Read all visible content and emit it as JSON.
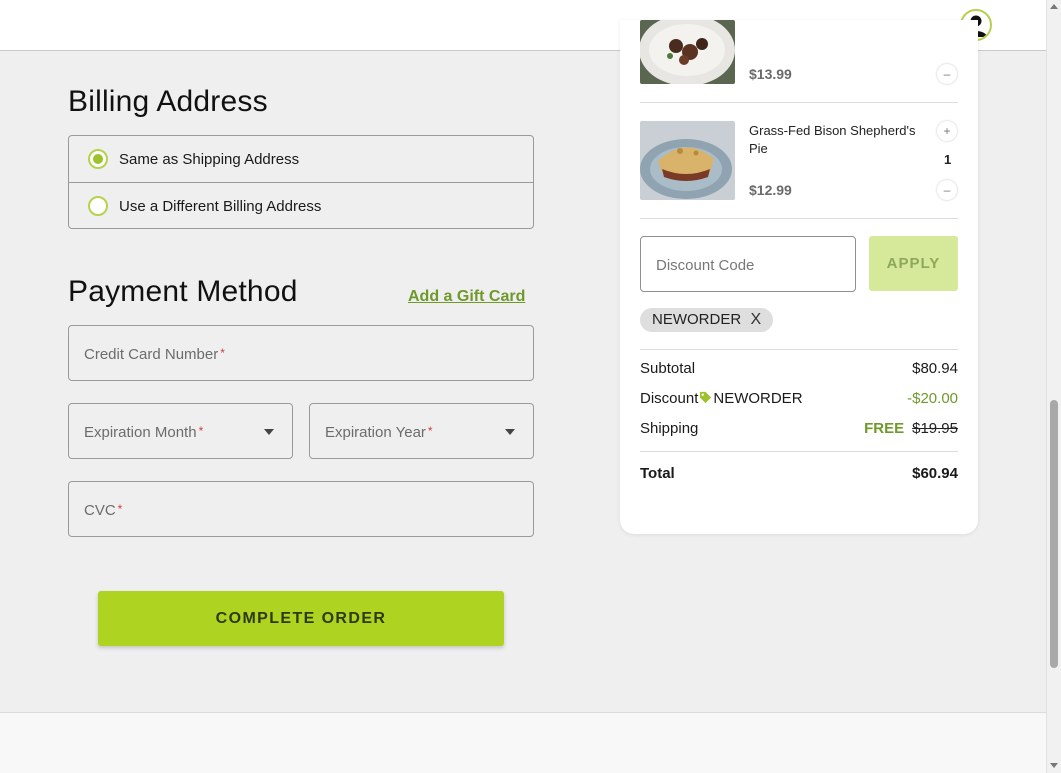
{
  "header": {
    "avatar_icon": "user-avatar-icon"
  },
  "billing": {
    "title": "Billing Address",
    "options": [
      {
        "label": "Same as Shipping Address",
        "selected": true
      },
      {
        "label": "Use a Different Billing Address",
        "selected": false
      }
    ]
  },
  "payment": {
    "title": "Payment Method",
    "gift_card_link": "Add a Gift Card",
    "card_number_label": "Credit Card Number",
    "exp_month_label": "Expiration Month",
    "exp_year_label": "Expiration Year",
    "cvc_label": "CVC",
    "required_marker": "*"
  },
  "complete_button": "COMPLETE ORDER",
  "cart": {
    "items": [
      {
        "name": "",
        "price": "$13.99",
        "minus": "–"
      },
      {
        "name": "Grass-Fed Bison Shepherd's Pie",
        "price": "$12.99",
        "qty": "1",
        "plus": "+",
        "minus": "–"
      }
    ],
    "discount_placeholder": "Discount Code",
    "apply_label": "APPLY",
    "applied_code": "NEWORDER",
    "remove_code": "X"
  },
  "summary": {
    "subtotal_label": "Subtotal",
    "subtotal_value": "$80.94",
    "discount_label": "Discount",
    "discount_code": "NEWORDER",
    "discount_value": "-$20.00",
    "shipping_label": "Shipping",
    "shipping_free": "FREE",
    "shipping_original": "$19.95",
    "total_label": "Total",
    "total_value": "$60.94"
  },
  "colors": {
    "accent_green": "#aed321",
    "link_green": "#6f9a2a",
    "required_red": "#d33c3c"
  }
}
